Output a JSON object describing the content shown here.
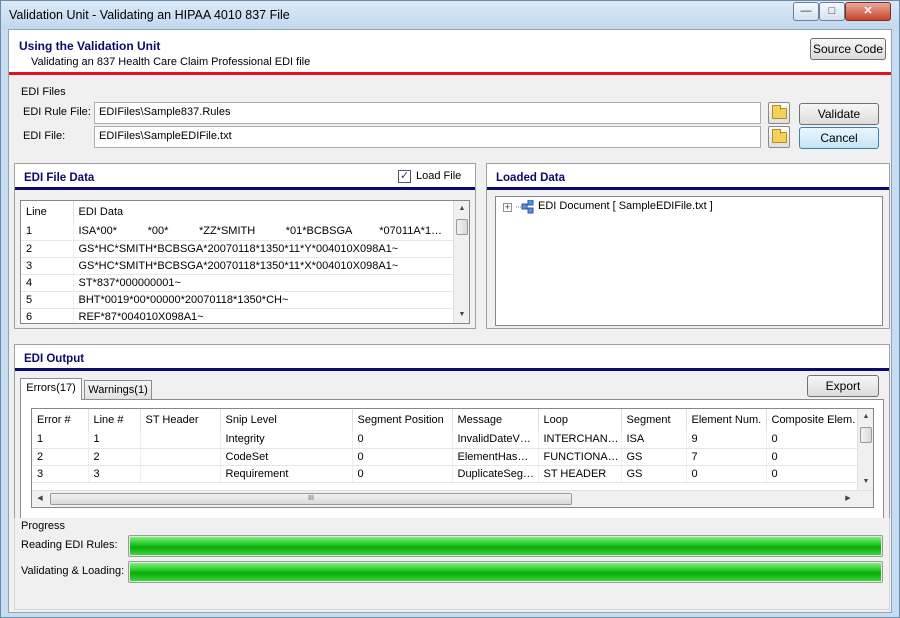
{
  "window": {
    "title": "Validation Unit - Validating an HIPAA 4010 837 File",
    "min_glyph": "—",
    "max_glyph": "□",
    "close_glyph": "✕"
  },
  "header": {
    "title": "Using the Validation Unit",
    "subtitle": "Validating an 837 Health Care Claim Professional EDI file",
    "source_code_label": "Source Code"
  },
  "edi_files": {
    "group_label": "EDI Files",
    "rule_file_label": "EDI Rule File:",
    "rule_file_value": "EDIFiles\\Sample837.Rules",
    "edi_file_label": "EDI File:",
    "edi_file_value": "EDIFiles\\SampleEDIFile.txt",
    "validate_label": "Validate",
    "cancel_label": "Cancel"
  },
  "edi_file_data": {
    "title": "EDI File Data",
    "load_file_label": "Load File",
    "load_file_checked": true,
    "columns": [
      "Line",
      "EDI Data"
    ],
    "rows": [
      [
        "1",
        "ISA*00*          *00*          *ZZ*SMITH          *01*BCBSGA         *07011A*1…"
      ],
      [
        "2",
        "GS*HC*SMITH*BCBSGA*20070118*1350*11*Y*004010X098A1~"
      ],
      [
        "3",
        "GS*HC*SMITH*BCBSGA*20070118*1350*11*X*004010X098A1~"
      ],
      [
        "4",
        "ST*837*000000001~"
      ],
      [
        "5",
        "BHT*0019*00*00000*20070118*1350*CH~"
      ],
      [
        "6",
        "REF*87*004010X098A1~"
      ]
    ]
  },
  "loaded_data": {
    "title": "Loaded Data",
    "tree_root": "EDI Document [ SampleEDIFile.txt ]"
  },
  "edi_output": {
    "title": "EDI Output",
    "tabs": [
      "Errors(17)",
      "Warnings(1)"
    ],
    "export_label": "Export",
    "columns": [
      "Error #",
      "Line #",
      "ST Header",
      "Snip Level",
      "Segment Position",
      "Message",
      "Loop",
      "Segment",
      "Element Num.",
      "Composite Elem."
    ],
    "rows": [
      [
        "1",
        "1",
        "",
        "Integrity",
        "0",
        "InvalidDateV…",
        "INTERCHAN…",
        "ISA",
        "9",
        "0"
      ],
      [
        "2",
        "2",
        "",
        "CodeSet",
        "0",
        "ElementHas…",
        "FUNCTIONA…",
        "GS",
        "7",
        "0"
      ],
      [
        "3",
        "3",
        "",
        "Requirement",
        "0",
        "DuplicateSeg…",
        "ST HEADER",
        "GS",
        "0",
        "0"
      ]
    ],
    "hscroll_grip": "III"
  },
  "progress": {
    "group_label": "Progress",
    "reading_label": "Reading EDI Rules:",
    "reading_value": 1.0,
    "validating_label": "Validating & Loading:",
    "validating_value": 1.0
  },
  "colors": {
    "accent_red": "#e0141e",
    "heading_navy": "#0a0a6e",
    "progress_green": "#18c418"
  }
}
